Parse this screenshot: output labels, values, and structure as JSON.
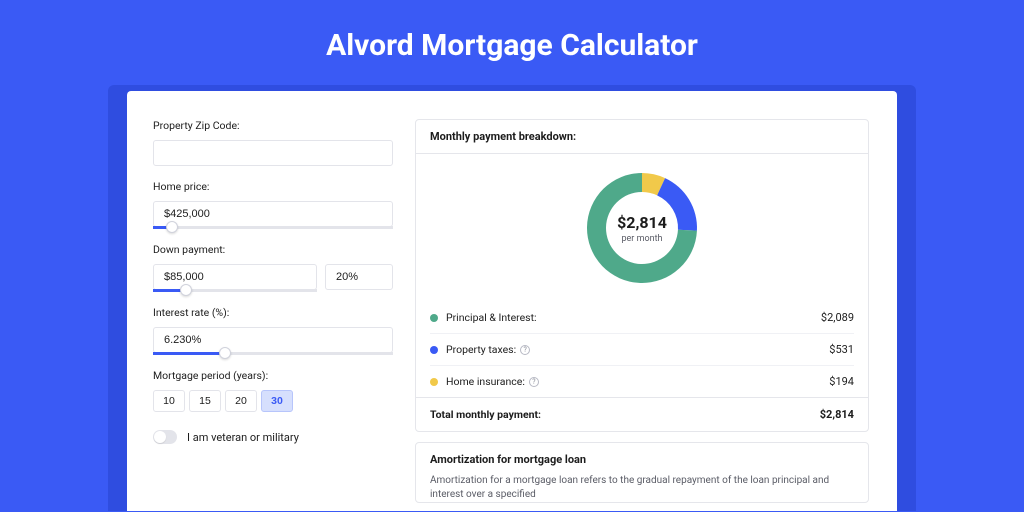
{
  "title": "Alvord Mortgage Calculator",
  "colors": {
    "principal": "#4fa98a",
    "taxes": "#3a5af5",
    "insurance": "#f1c94a"
  },
  "form": {
    "zip": {
      "label": "Property Zip Code:",
      "value": ""
    },
    "price": {
      "label": "Home price:",
      "value": "$425,000",
      "slider_pct": 8
    },
    "down": {
      "label": "Down payment:",
      "value": "$85,000",
      "pct_value": "20%",
      "slider_pct": 20
    },
    "rate": {
      "label": "Interest rate (%):",
      "value": "6.230%",
      "slider_pct": 30
    },
    "period": {
      "label": "Mortgage period (years):",
      "options": [
        "10",
        "15",
        "20",
        "30"
      ],
      "selected": "30"
    },
    "veteran_label": "I am veteran or military"
  },
  "breakdown": {
    "heading": "Monthly payment breakdown:",
    "center_amount": "$2,814",
    "center_sub": "per month",
    "items": [
      {
        "label": "Principal & Interest:",
        "value": "$2,089",
        "info": false,
        "color_key": "principal"
      },
      {
        "label": "Property taxes:",
        "value": "$531",
        "info": true,
        "color_key": "taxes"
      },
      {
        "label": "Home insurance:",
        "value": "$194",
        "info": true,
        "color_key": "insurance"
      }
    ],
    "total_label": "Total monthly payment:",
    "total_value": "$2,814"
  },
  "amort": {
    "title": "Amortization for mortgage loan",
    "text": "Amortization for a mortgage loan refers to the gradual repayment of the loan principal and interest over a specified"
  },
  "chart_data": {
    "type": "pie",
    "title": "Monthly payment breakdown",
    "categories": [
      "Principal & Interest",
      "Property taxes",
      "Home insurance"
    ],
    "values": [
      2089,
      531,
      194
    ],
    "total": 2814,
    "ylabel": "USD per month"
  }
}
